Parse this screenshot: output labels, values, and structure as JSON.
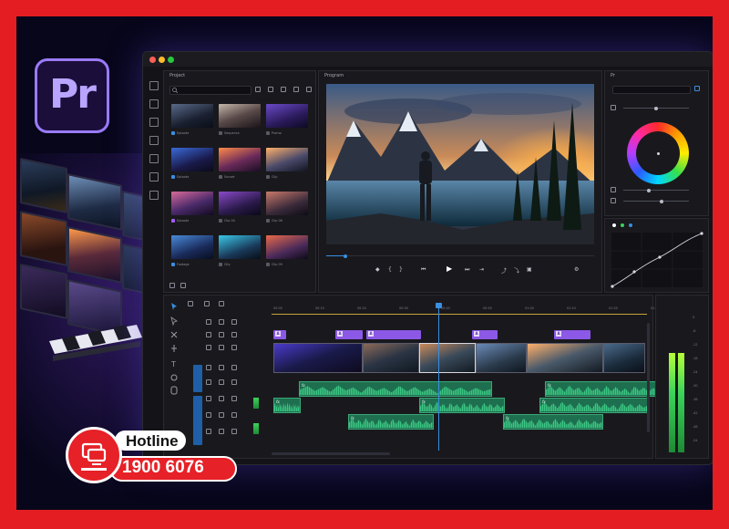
{
  "logo": {
    "text": "Pr"
  },
  "window": {
    "traffic_lights": [
      "#ff5f57",
      "#febc2e",
      "#28c840"
    ]
  },
  "project_panel": {
    "title": "Project",
    "thumbnails": [
      {
        "label": "Episode",
        "swatch": "#3a8fe0"
      },
      {
        "label": "Sequence",
        "swatch": "#5a5a66"
      },
      {
        "label": "Promo",
        "swatch": "#5a5a66"
      },
      {
        "label": "Episode",
        "swatch": "#3a8fe0"
      },
      {
        "label": "Sunset",
        "swatch": "#5a5a66"
      },
      {
        "label": "Clip",
        "swatch": "#5a5a66"
      },
      {
        "label": "Episode",
        "swatch": "#a25cf0"
      },
      {
        "label": "Clip 04",
        "swatch": "#5a5a66"
      },
      {
        "label": "Clip 06",
        "swatch": "#5a5a66"
      },
      {
        "label": "Footage",
        "swatch": "#3a8fe0"
      },
      {
        "label": "City",
        "swatch": "#5a5a66"
      },
      {
        "label": "Clip 09",
        "swatch": "#5a5a66"
      }
    ]
  },
  "program_panel": {
    "title": "Program",
    "playhead_fraction": 0.07,
    "controls": [
      "marker-icon",
      "in-point-icon",
      "out-point-icon",
      "step-back-icon",
      "play-icon",
      "step-forward-icon",
      "out-icon",
      "lift-icon",
      "extract-icon",
      "export-frame-icon",
      "settings-icon"
    ]
  },
  "color_panel": {
    "title": "Pr",
    "accent": "#3a8fe0",
    "curve_dots": [
      "#ffffff",
      "#3ad45a",
      "#3a8fe0"
    ]
  },
  "timeline": {
    "ruler_ticks": [
      "00:00",
      "00:10",
      "00:20",
      "00:30",
      "00:40",
      "00:50",
      "01:00",
      "01:10",
      "01:20",
      "01:30"
    ],
    "pclip_glyph": "fx",
    "audio_fx": "fx"
  },
  "meters": {
    "scale": [
      "0",
      "-6",
      "-12",
      "-18",
      "-24",
      "-30",
      "-36",
      "-42",
      "-48",
      "-54"
    ],
    "level_left": 0.73,
    "level_right": 0.73
  },
  "hotline": {
    "label": "Hotline",
    "number": "1900 6076"
  }
}
